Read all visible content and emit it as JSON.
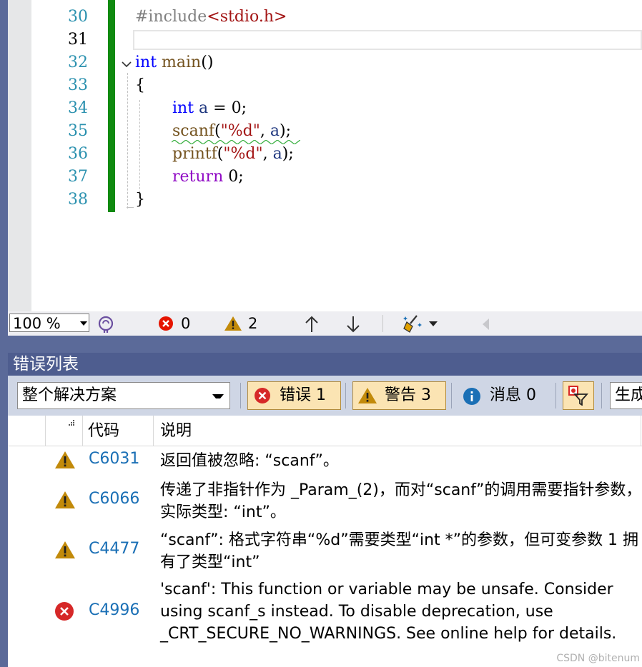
{
  "editor": {
    "line_numbers": [
      "30",
      "31",
      "32",
      "33",
      "34",
      "35",
      "36",
      "37",
      "38"
    ],
    "current_line": "31",
    "lines": {
      "l30_pre": "#include",
      "l30_hdr": "<stdio.h>",
      "l32_kw": "int",
      "l32_fn": "main",
      "l32_rest": "()",
      "l33": "{",
      "l34_kw": "int",
      "l34_var": "a",
      "l34_rest": " = 0;",
      "l35_fn": "scanf",
      "l35_open": "(",
      "l35_str": "\"%d\"",
      "l35_comma": ", ",
      "l35_var": "a",
      "l35_close": ");",
      "l36_fn": "printf",
      "l36_open": "(",
      "l36_str": "\"%d\"",
      "l36_comma": ", ",
      "l36_var": "a",
      "l36_close": ");",
      "l37_kw": "return",
      "l37_rest": " 0;",
      "l38": "}"
    }
  },
  "statusbar": {
    "zoom": "100 %",
    "errors": "0",
    "warnings": "2"
  },
  "error_list": {
    "title": "错误列表",
    "scope": "整个解决方案",
    "errors_filter": "错误 1",
    "warnings_filter": "警告 3",
    "messages_filter": "消息 0",
    "build_truncated": "生成",
    "columns": {
      "code": "代码",
      "desc": "说明"
    },
    "rows": [
      {
        "severity": "warning",
        "code": "C6031",
        "desc": "返回值被忽略: “scanf”。"
      },
      {
        "severity": "warning",
        "code": "C6066",
        "desc": "传递了非指针作为 _Param_(2)，而对“scanf”的调用需要指针参数，实际类型: “int”。"
      },
      {
        "severity": "warning",
        "code": "C4477",
        "desc": "“scanf”: 格式字符串“%d”需要类型“int *”的参数，但可变参数 1 拥有了类型“int”"
      },
      {
        "severity": "error",
        "code": "C4996",
        "desc": "'scanf': This function or variable may be unsafe. Consider using scanf_s instead. To disable deprecation, use _CRT_SECURE_NO_WARNINGS. See online help for details."
      }
    ]
  },
  "watermark": "CSDN @bitenum",
  "colors": {
    "error": "#e51400",
    "warning": "#c28a0a",
    "info": "#1a6fb5",
    "accent": "#4e5d8f"
  }
}
